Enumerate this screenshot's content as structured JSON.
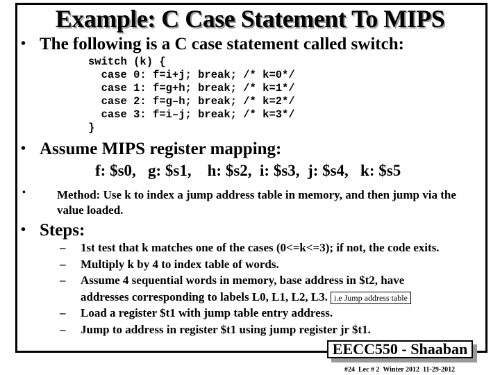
{
  "title": "Example: C Case Statement To MIPS",
  "intro": {
    "bullet": "•",
    "text": "The following is a C case statement called switch:"
  },
  "code": {
    "lines": [
      "switch (k) {",
      "  case 0: f=i+j; break; /* k=0*/",
      "  case 1: f=g+h; break; /* k=1*/",
      "  case 2: f=g–h; break; /* k=2*/",
      "  case 3: f=i–j; break; /* k=3*/",
      "}"
    ]
  },
  "mapping": {
    "bullet": "•",
    "text": "Assume MIPS register mapping:",
    "registers": "f: $s0,   g: $s1,    h: $s2,  i: $s3,  j: $s4,   k: $s5"
  },
  "method": {
    "bullet": "•",
    "text": "Method: Use k to index a jump address table in memory, and then jump via the value loaded."
  },
  "steps": {
    "bullet": "•",
    "heading": "Steps:",
    "dash": "–",
    "items": [
      "1st test that k matches one of the cases (0<=k<=3); if not, the code exits.",
      "Multiply k by 4 to index table of words.",
      "Assume 4 sequential words in memory, base address in $t2, have",
      "addresses corresponding to labels L0, L1, L2, L3.",
      "Load a register $t1 with jump table entry address.",
      "Jump to address in register $t1  using jump register  jr $t1."
    ],
    "note": "i.e Jump address table"
  },
  "footer": {
    "course": "EECC550 - Shaaban",
    "info": "#24  Lec # 2  Winter 2012  11-29-2012"
  }
}
